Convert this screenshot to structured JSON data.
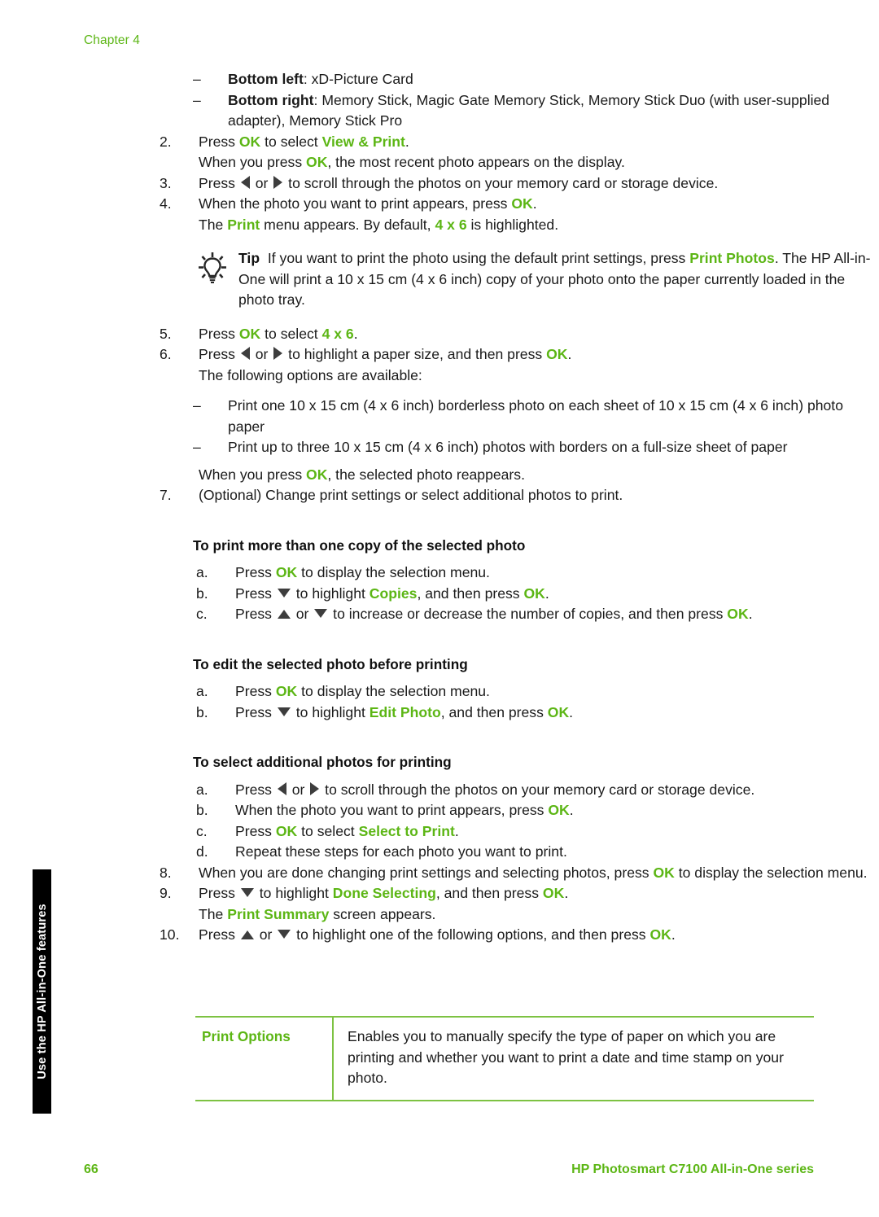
{
  "header": {
    "chapter_label": "Chapter 4"
  },
  "side_tab": {
    "label": "Use the HP All-in-One features"
  },
  "colors": {
    "accent_green": "#5CB615",
    "rule_green": "#7DC242",
    "body_text": "#1a1a1a",
    "tab_background": "#000000"
  },
  "body": {
    "bullets_top": [
      {
        "marker": "–",
        "lead": "Bottom left",
        "text": ": xD-Picture Card"
      },
      {
        "marker": "–",
        "lead": "Bottom right",
        "text": ": Memory Stick, Magic Gate Memory Stick, Memory Stick Duo (with user-supplied adapter), Memory Stick Pro"
      }
    ],
    "step2": {
      "marker": "2.",
      "pre": "Press ",
      "key1": "OK",
      "mid": " to select ",
      "key2": "View & Print",
      "post": ".",
      "sub": {
        "pre": "When you press ",
        "key": "OK",
        "post": ", the most recent photo appears on the display."
      }
    },
    "step3": {
      "marker": "3.",
      "pre": "Press ",
      "mid": " or ",
      "post": " to scroll through the photos on your memory card or storage device."
    },
    "step4": {
      "marker": "4.",
      "pre": "When the photo you want to print appears, press ",
      "key": "OK",
      "post": ".",
      "sub": {
        "pre": "The ",
        "key1": "Print",
        "mid": " menu appears. By default, ",
        "key2": "4 x 6",
        "post": " is highlighted."
      }
    },
    "tip": {
      "icon": "lightbulb-icon",
      "label": "Tip",
      "pre": "If you want to print the photo using the default print settings, press ",
      "key": "Print Photos",
      "post": ". The HP All-in-One will print a 10 x 15 cm (4 x 6 inch) copy of your photo onto the paper currently loaded in the photo tray."
    },
    "step5": {
      "marker": "5.",
      "pre": "Press ",
      "key1": "OK",
      "mid": " to select ",
      "key2": "4 x 6",
      "post": "."
    },
    "step6": {
      "marker": "6.",
      "pre": "Press ",
      "mid": " or ",
      "mid2": " to highlight a paper size, and then press ",
      "key": "OK",
      "post": ".",
      "sub": "The following options are available:",
      "options": [
        "Print one 10 x 15 cm (4 x 6 inch) borderless photo on each sheet of 10 x 15 cm (4 x 6 inch) photo paper",
        "Print up to three 10 x 15 cm (4 x 6 inch) photos with borders on a full-size sheet of paper"
      ],
      "closing": {
        "pre": "When you press ",
        "key": "OK",
        "post": ", the selected photo reappears."
      }
    },
    "step7": {
      "marker": "7.",
      "text": "(Optional) Change print settings or select additional photos to print."
    },
    "section_copies": {
      "heading": "To print more than one copy of the selected photo",
      "items": [
        {
          "marker": "a.",
          "pre": "Press ",
          "key": "OK",
          "post": " to display the selection menu."
        },
        {
          "marker": "b.",
          "pre": "Press ",
          "mid": " to highlight ",
          "key1": "Copies",
          "mid2": ", and then press ",
          "key2": "OK",
          "post": "."
        },
        {
          "marker": "c.",
          "pre": "Press ",
          "mid": " or ",
          "mid2": " to increase or decrease the number of copies, and then press ",
          "key": "OK",
          "post": "."
        }
      ]
    },
    "section_edit": {
      "heading": "To edit the selected photo before printing",
      "items": [
        {
          "marker": "a.",
          "pre": "Press ",
          "key": "OK",
          "post": " to display the selection menu."
        },
        {
          "marker": "b.",
          "pre": "Press ",
          "mid": " to highlight ",
          "key1": "Edit Photo",
          "mid2": ", and then press ",
          "key2": "OK",
          "post": "."
        }
      ]
    },
    "section_additional": {
      "heading": "To select additional photos for printing",
      "items": [
        {
          "marker": "a.",
          "pre": "Press ",
          "mid": " or ",
          "post": " to scroll through the photos on your memory card or storage device."
        },
        {
          "marker": "b.",
          "pre": "When the photo you want to print appears, press ",
          "key": "OK",
          "post": "."
        },
        {
          "marker": "c.",
          "pre": "Press ",
          "key1": "OK",
          "mid": " to select ",
          "key2": "Select to Print",
          "post": "."
        },
        {
          "marker": "d.",
          "text": "Repeat these steps for each photo you want to print."
        }
      ]
    },
    "step8": {
      "marker": "8.",
      "pre": "When you are done changing print settings and selecting photos, press ",
      "key": "OK",
      "post": " to display the selection menu."
    },
    "step9": {
      "marker": "9.",
      "pre": "Press ",
      "mid": " to highlight ",
      "key1": "Done Selecting",
      "mid2": ", and then press ",
      "key2": "OK",
      "post": ".",
      "sub": {
        "pre": "The ",
        "key": "Print Summary",
        "post": " screen appears."
      }
    },
    "step10": {
      "marker": "10.",
      "pre": "Press ",
      "mid": " or ",
      "mid2": " to highlight one of the following options, and then press ",
      "key": "OK",
      "post": "."
    }
  },
  "options_table": {
    "rows": [
      {
        "label": "Print Options",
        "description": "Enables you to manually specify the type of paper on which you are printing and whether you want to print a date and time stamp on your photo."
      }
    ]
  },
  "footer": {
    "page_number": "66",
    "product_title": "HP Photosmart C7100 All-in-One series"
  }
}
